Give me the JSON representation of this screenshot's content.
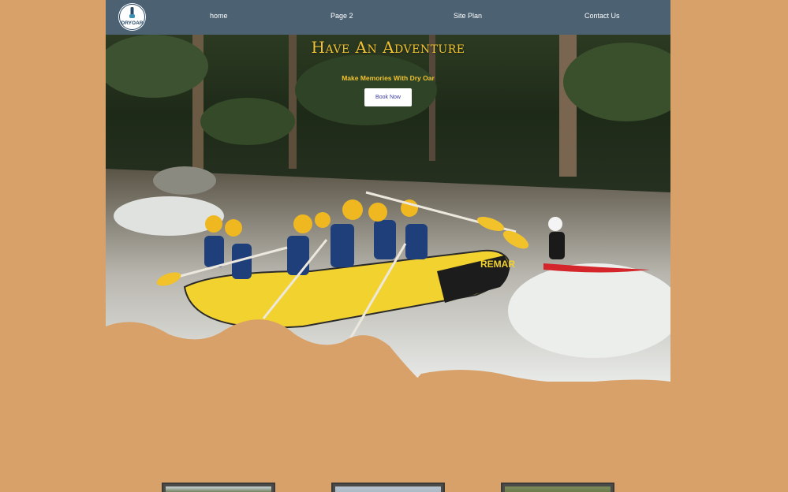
{
  "brand": {
    "logo_text": "DRYOAR",
    "logo_alt": "logo-icon"
  },
  "nav": {
    "items": [
      {
        "label": "home"
      },
      {
        "label": "Page 2"
      },
      {
        "label": "Site Plan"
      },
      {
        "label": "Contact Us"
      }
    ]
  },
  "hero": {
    "title": "Have An Adventure",
    "subtitle": "Make Memories With Dry Oar",
    "cta_label": "Book Now",
    "raft_brand": "REMAR",
    "image_icon": "rafting-photo"
  },
  "colors": {
    "background": "#d9a16a",
    "nav": "#4c6273",
    "accent": "#f1c232",
    "cta_text": "#3a3aa0"
  },
  "gallery": {
    "thumbnails": [
      {
        "icon": "photo-thumbnail"
      },
      {
        "icon": "photo-thumbnail"
      },
      {
        "icon": "photo-thumbnail"
      }
    ]
  }
}
